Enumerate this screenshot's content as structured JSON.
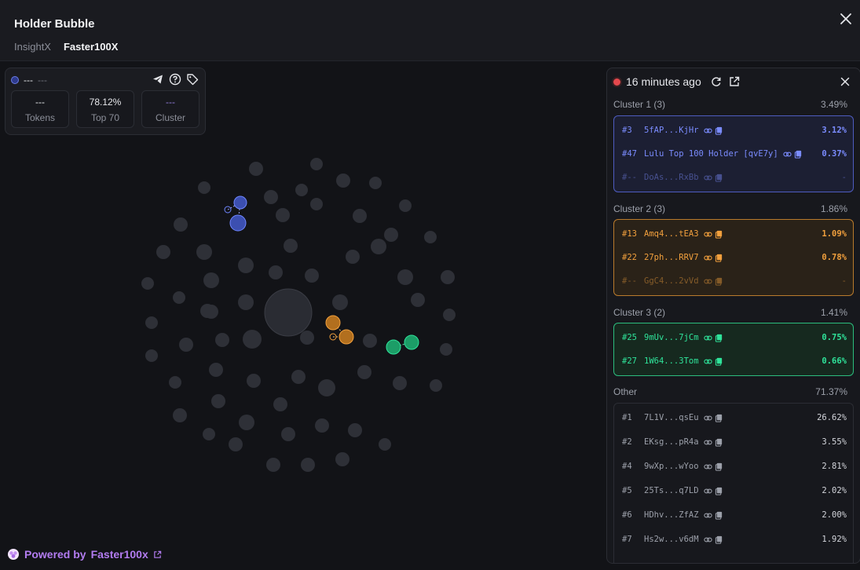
{
  "header": {
    "title": "Holder Bubble",
    "tabs": [
      {
        "label": "InsightX",
        "active": false
      },
      {
        "label": "Faster100X",
        "active": true
      }
    ]
  },
  "stats": {
    "token_name": "---",
    "token_symbol": "---",
    "boxes": [
      {
        "value": "---",
        "label": "Tokens"
      },
      {
        "value": "78.12%",
        "label": "Top 70"
      },
      {
        "value": "---",
        "label": "Cluster"
      }
    ]
  },
  "holders_panel": {
    "updated": "16 minutes ago",
    "clusters": [
      {
        "name": "Cluster 1 (3)",
        "percent": "3.49%",
        "color": "#6f86ff",
        "rows": [
          {
            "rank": "#3",
            "address": "5fAP...KjHr",
            "percent": "3.12%"
          },
          {
            "rank": "#47",
            "address": "Lulu Top 100 Holder [qvE7y]",
            "percent": "0.37%"
          },
          {
            "rank": "#--",
            "address": "DoAs...RxBb",
            "percent": "-"
          }
        ]
      },
      {
        "name": "Cluster 2 (3)",
        "percent": "1.86%",
        "color": "#f2a03d",
        "rows": [
          {
            "rank": "#13",
            "address": "Amq4...tEA3",
            "percent": "1.09%"
          },
          {
            "rank": "#22",
            "address": "27ph...RRV7",
            "percent": "0.78%"
          },
          {
            "rank": "#--",
            "address": "GgC4...2vVd",
            "percent": "-"
          }
        ]
      },
      {
        "name": "Cluster 3 (2)",
        "percent": "1.41%",
        "color": "#2fe39a",
        "rows": [
          {
            "rank": "#25",
            "address": "9mUv...7jCm",
            "percent": "0.75%"
          },
          {
            "rank": "#27",
            "address": "1W64...3Tom",
            "percent": "0.66%"
          }
        ]
      }
    ],
    "other": {
      "name": "Other",
      "percent": "71.37%",
      "rows": [
        {
          "rank": "#1",
          "address": "7L1V...qsEu",
          "percent": "26.62%"
        },
        {
          "rank": "#2",
          "address": "EKsg...pR4a",
          "percent": "3.55%"
        },
        {
          "rank": "#4",
          "address": "9wXp...wYoo",
          "percent": "2.81%"
        },
        {
          "rank": "#5",
          "address": "25Ts...q7LD",
          "percent": "2.02%"
        },
        {
          "rank": "#6",
          "address": "HDhv...ZfAZ",
          "percent": "2.00%"
        },
        {
          "rank": "#7",
          "address": "Hs2w...v6dM",
          "percent": "1.92%"
        }
      ]
    }
  },
  "footer": {
    "powered_label": "Powered by",
    "brand": "Faster100x"
  },
  "colors": {
    "bubble": "#2e3037",
    "cluster1": "#3c4fb0",
    "cluster2": "#b26f1e",
    "cluster3": "#1c9d67",
    "accent": "#b27cf0"
  },
  "icons": [
    "telegram-icon",
    "help-icon",
    "tag-icon",
    "refresh-icon",
    "external-link-icon",
    "close-icon",
    "link-icon",
    "copy-icon"
  ]
}
